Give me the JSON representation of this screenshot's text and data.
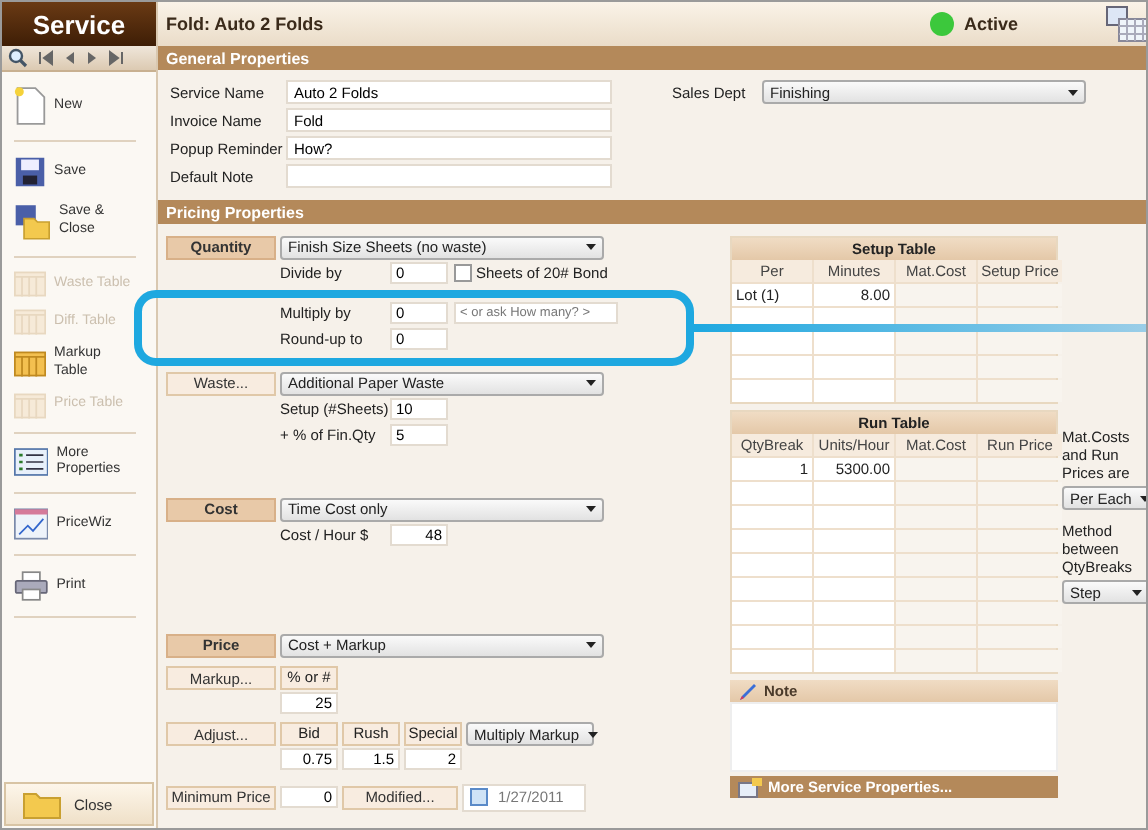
{
  "sidebar": {
    "title": "Service",
    "items": [
      {
        "label": "New",
        "kind": "new",
        "disabled": false,
        "separator_after": true
      },
      {
        "label": "Save",
        "kind": "save",
        "disabled": false,
        "separator_after": false
      },
      {
        "label": "Save & Close",
        "kind": "saveclose",
        "disabled": false,
        "separator_after": true
      },
      {
        "label": "Waste Table",
        "kind": "table",
        "disabled": true,
        "separator_after": false
      },
      {
        "label": "Diff. Table",
        "kind": "table",
        "disabled": true,
        "separator_after": false
      },
      {
        "label": "Markup Table",
        "kind": "table",
        "disabled": false,
        "separator_after": false
      },
      {
        "label": "Price Table",
        "kind": "table",
        "disabled": true,
        "separator_after": true
      },
      {
        "label": "More Properties",
        "kind": "list",
        "disabled": false,
        "separator_after": true
      },
      {
        "label": "PriceWiz",
        "kind": "wiz",
        "disabled": false,
        "separator_after": true
      },
      {
        "label": "Print",
        "kind": "print",
        "disabled": false,
        "separator_after": true
      }
    ],
    "close": "Close"
  },
  "header": {
    "title": "Fold: Auto 2 Folds",
    "status": {
      "label": "Active",
      "on": true
    }
  },
  "general": {
    "section_title": "General Properties",
    "fields": [
      {
        "label": "Service Name",
        "value": "Auto 2 Folds"
      },
      {
        "label": "Invoice Name",
        "value": "Fold"
      },
      {
        "label": "Popup Reminder",
        "value": "How?"
      },
      {
        "label": "Default Note"
      }
    ],
    "sales_dept": {
      "label": "Sales Dept",
      "value": "Finishing"
    }
  },
  "pricing": {
    "section_title": "Pricing Properties",
    "quantity": {
      "button": "Quantity",
      "select": "Finish Size Sheets (no waste)",
      "fields": [
        {
          "label": "Divide by",
          "value": "0",
          "kind": "check",
          "check_label": "Sheets of 20# Bond",
          "checked": false
        },
        {
          "label": "Multiply by",
          "value": "0",
          "kind": "ask",
          "placeholder": "< or ask How many? >"
        },
        {
          "label": "Round-up to",
          "value": "0",
          "kind": "plain"
        }
      ]
    },
    "waste": {
      "button": "Waste...",
      "select": "Additional Paper Waste",
      "fields": [
        {
          "label": "Setup (#Sheets)",
          "value": "10"
        },
        {
          "label": "+ % of Fin.Qty",
          "value": "5"
        }
      ]
    },
    "cost": {
      "button": "Cost",
      "select": "Time Cost only",
      "label": "Cost / Hour",
      "currency": "$",
      "value": "48"
    },
    "price": {
      "button": "Price",
      "select": "Cost + Markup",
      "markup": {
        "button": "Markup...",
        "header": "% or #",
        "value": "25"
      },
      "adjust": {
        "button": "Adjust...",
        "columns": [
          {
            "header": "Bid",
            "value": "0.75"
          },
          {
            "header": "Rush",
            "value": "1.5"
          },
          {
            "header": "Special",
            "value": "2"
          }
        ],
        "select": "Multiply Markup"
      },
      "minimum": {
        "button": "Minimum Price",
        "value": "0",
        "modified": "Modified...",
        "checked": false,
        "date": "1/27/2011"
      }
    }
  },
  "setup_table": {
    "title": "Setup Table",
    "columns": [
      "Per",
      "Minutes",
      "Mat.Cost",
      "Setup Price"
    ],
    "rows": [
      [
        "Lot (1)",
        "8.00",
        "",
        ""
      ]
    ]
  },
  "run_table": {
    "title": "Run Table",
    "columns": [
      "QtyBreak",
      "Units/Hour",
      "Mat.Cost",
      "Run Price"
    ],
    "rows": [
      [
        "1",
        "5300.00",
        "",
        ""
      ]
    ]
  },
  "options": [
    {
      "label": "Mat.Costs and Run Prices are",
      "value": "Per Each"
    },
    {
      "label": "Method between QtyBreaks",
      "value": "Step"
    }
  ],
  "note": {
    "title": "Note"
  },
  "more": "More Service Properties..."
}
